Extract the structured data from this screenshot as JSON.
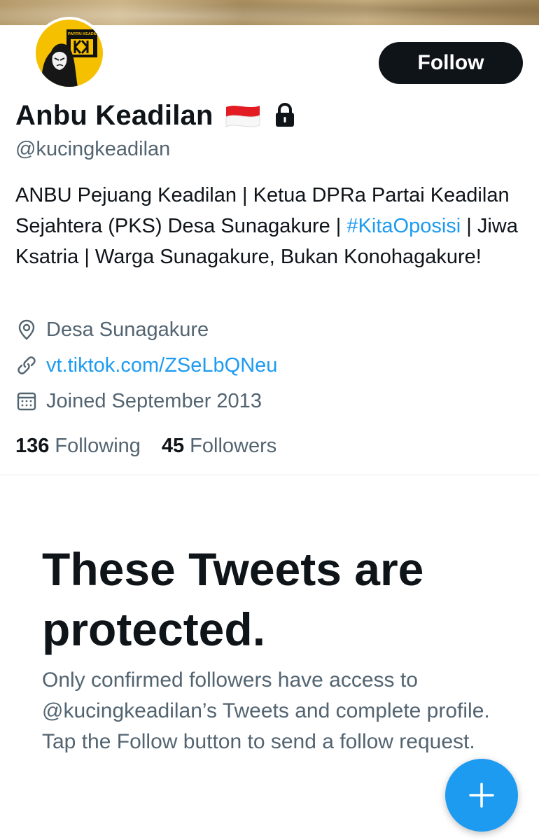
{
  "header": {
    "follow_label": "Follow"
  },
  "profile": {
    "display_name": "Anbu Keadilan",
    "handle": "@kucingkeadilan",
    "avatar_text": "PARTAI KEADILAN",
    "bio_part1": "ANBU Pejuang Keadilan | Ketua DPRa Partai Keadilan Sejahtera (PKS) Desa Sunagakure | ",
    "bio_hashtag": "#KitaOposisi",
    "bio_part2": " | Jiwa Ksatria | Warga Sunagakure, Bukan Konohagakure!",
    "location": "Desa Sunagakure",
    "website": "vt.tiktok.com/ZSeLbQNeu",
    "joined": "Joined September 2013",
    "following_count": "136",
    "following_label": "Following",
    "followers_count": "45",
    "followers_label": "Followers"
  },
  "protected": {
    "title": "These Tweets are protected.",
    "body": "Only confirmed followers have access to @kucingkeadilan’s Tweets and complete profile. Tap the Follow button to send a follow request."
  },
  "icons": {
    "location": "location-pin-icon",
    "link": "link-icon",
    "calendar": "calendar-icon",
    "lock": "lock-icon",
    "flag": "indonesia-flag-icon",
    "fab": "plus-icon"
  },
  "colors": {
    "accent": "#1d9bf0",
    "text": "#0f1419",
    "secondary": "#536471",
    "avatar_bg": "#f5c000"
  }
}
